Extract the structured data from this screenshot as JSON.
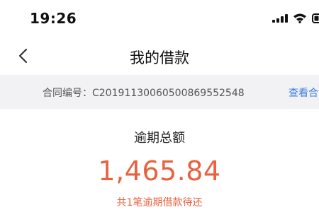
{
  "status_bar": {
    "time": "19:26",
    "icons": [
      "signal-icon",
      "wifi-icon",
      "battery-icon"
    ]
  },
  "nav": {
    "back_icon": "chevron-left-icon",
    "title": "我的借款"
  },
  "contract": {
    "label": "合同编号：C20191130060500869552548",
    "link_text": "查看合"
  },
  "summary": {
    "label": "逾期总额",
    "amount": "1,465.84",
    "note": "共1笔逾期借款待还"
  },
  "colors": {
    "accent": "#e8623f",
    "link": "#3a7de4",
    "contract_bar_bg": "#f2f2f4"
  }
}
